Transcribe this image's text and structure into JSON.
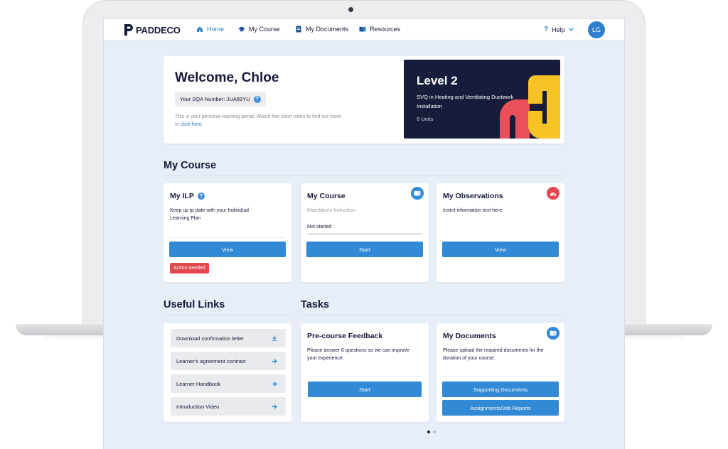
{
  "nav": {
    "logo_text": "PADDECO",
    "items": [
      {
        "label": "Home",
        "icon": "home-icon",
        "active": true
      },
      {
        "label": "My Course",
        "icon": "graduation-cap-icon",
        "active": false
      },
      {
        "label": "My Documents",
        "icon": "document-icon",
        "active": false
      },
      {
        "label": "Resources",
        "icon": "books-icon",
        "active": false
      }
    ],
    "help_label": "Help",
    "avatar_initials": "LG"
  },
  "welcome": {
    "title": "Welcome, Chloe",
    "sqa_label": "Your SQA Number: JUA89YU",
    "intro_text": "This is your personal learning portal. Watch this short video to find out more or",
    "intro_link": "click here."
  },
  "level_card": {
    "title": "Level 2",
    "qualification": "SVQ in Heating and Ventilating Ductwork Installation",
    "units": "6 Units"
  },
  "my_course_section": {
    "heading": "My Course",
    "ilp": {
      "title": "My ILP",
      "text": "Keep up tp date with your Individual Learning Plan",
      "button": "View",
      "badge": "Action needed"
    },
    "course": {
      "title": "My Course",
      "subtitle": "Mandatory Induction",
      "status": "Not started",
      "progress": 0,
      "button": "Start"
    },
    "observations": {
      "title": "My Observations",
      "text": "Insert information text here",
      "button": "View"
    }
  },
  "useful_links": {
    "heading": "Useful Links",
    "items": [
      {
        "label": "Download confirmation letter",
        "icon": "download-icon"
      },
      {
        "label": "Learner's agreement contract",
        "icon": "arrow-right-icon"
      },
      {
        "label": "Learner Handbook",
        "icon": "arrow-right-icon"
      },
      {
        "label": "Introduction Video",
        "icon": "arrow-right-icon"
      }
    ]
  },
  "tasks": {
    "heading": "Tasks",
    "feedback": {
      "title": "Pre-course Feedback",
      "text": "Please answer 6 questions so we can improve your experience.",
      "button": "Start"
    },
    "documents": {
      "title": "My Documents",
      "text": "Please upload the required documents for the duration of your course.",
      "button_1": "Supporting Documents",
      "button_2": "Assignments/Job Reports"
    }
  },
  "colors": {
    "primary": "#3289d6",
    "navy": "#161c3a",
    "danger": "#e2474e",
    "level_yellow": "#f6c226",
    "level_coral": "#ea4f5a",
    "background": "#e7eef8"
  }
}
